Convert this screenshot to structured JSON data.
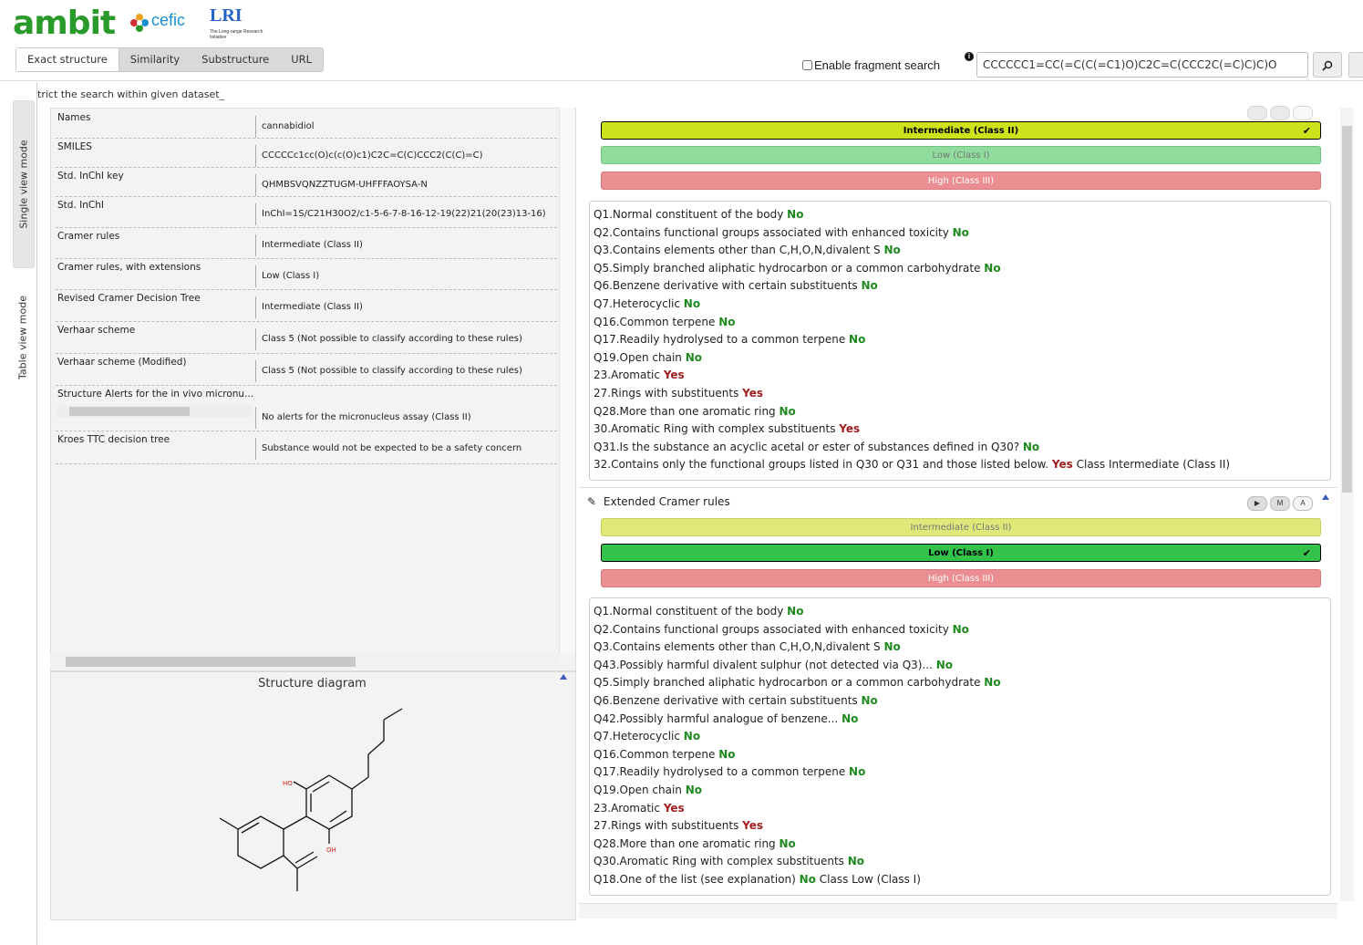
{
  "brand": {
    "logo": "ambit",
    "partner1": "cefic",
    "partner2": "LRI",
    "partner2_sub": "The Long-range Research Initiative"
  },
  "tabs": [
    {
      "label": "Exact structure"
    },
    {
      "label": "Similarity"
    },
    {
      "label": "Substructure"
    },
    {
      "label": "URL"
    }
  ],
  "search": {
    "fragment_label": "Enable fragment search",
    "fragment_checked": false,
    "value": "CCCCCC1=CC(=C(C(=C1)O)C2C=C(CCC2C(=C)C)C)O"
  },
  "side_tabs": {
    "single": "Single view mode",
    "table": "Table view mode"
  },
  "restrict_text": "trict the search within given dataset_",
  "properties": [
    {
      "name": "Names",
      "value": "cannabidiol"
    },
    {
      "name": "SMILES",
      "value": "CCCCCc1cc(O)c(c(O)c1)C2C=C(C)CCC2(C(C)=C)"
    },
    {
      "name": "Std. InChI key",
      "value": "QHMBSVQNZZTUGM-UHFFFAOYSA-N"
    },
    {
      "name": "Std. InChI",
      "value": "InChI=1S/C21H30O2/c1-5-6-7-8-16-12-19(22)21(20(23)13-16)"
    },
    {
      "name": "Cramer rules",
      "value": "Intermediate (Class II)"
    },
    {
      "name": "Cramer rules, with extensions",
      "value": "Low (Class I)"
    },
    {
      "name": "Revised Cramer Decision Tree",
      "value": "Intermediate (Class II)"
    },
    {
      "name": "Verhaar scheme",
      "value": "Class 5 (Not possible to classify according to these rules)"
    },
    {
      "name": "Verhaar scheme (Modified)",
      "value": "Class 5 (Not possible to classify according to these rules)"
    },
    {
      "name": "Structure Alerts for the in vivo micronu...",
      "value": "No alerts for the micronucleus assay (Class II)"
    },
    {
      "name": "Kroes TTC decision tree",
      "value": "Substance would not be expected to be a safety concern"
    }
  ],
  "structure": {
    "title": "Structure diagram",
    "atoms": {
      "ho": "HO",
      "oh": "OH"
    }
  },
  "cramer": {
    "classes": {
      "intermediate": "Intermediate (Class II)",
      "low": "Low (Class I)",
      "high": "High (Class III)"
    },
    "questions": [
      {
        "q": "Q1.Normal constituent of the body ",
        "a": "No"
      },
      {
        "q": "Q2.Contains functional groups associated with enhanced toxicity ",
        "a": "No"
      },
      {
        "q": "Q3.Contains elements other than C,H,O,N,divalent S ",
        "a": "No"
      },
      {
        "q": "Q5.Simply branched aliphatic hydrocarbon or a common carbohydrate ",
        "a": "No"
      },
      {
        "q": "Q6.Benzene derivative with certain substituents ",
        "a": "No"
      },
      {
        "q": "Q7.Heterocyclic ",
        "a": "No"
      },
      {
        "q": "Q16.Common terpene ",
        "a": "No"
      },
      {
        "q": "Q17.Readily hydrolysed to a common terpene ",
        "a": "No"
      },
      {
        "q": "Q19.Open chain ",
        "a": "No"
      },
      {
        "q": "23.Aromatic ",
        "a": "Yes"
      },
      {
        "q": "27.Rings with substituents ",
        "a": "Yes"
      },
      {
        "q": "Q28.More than one aromatic ring ",
        "a": "No"
      },
      {
        "q": "30.Aromatic Ring with complex substituents ",
        "a": "Yes"
      },
      {
        "q": "Q31.Is the substance an acyclic acetal or ester of substances defined in Q30? ",
        "a": "No"
      },
      {
        "q": "32.Contains only the functional groups listed in Q30 or Q31 and those listed below. ",
        "a": "Yes",
        "tail": " Class Intermediate (Class II)"
      }
    ]
  },
  "extended": {
    "title": "Extended Cramer rules",
    "buttons": [
      "▶",
      "M",
      "A"
    ],
    "questions": [
      {
        "q": "Q1.Normal constituent of the body ",
        "a": "No"
      },
      {
        "q": "Q2.Contains functional groups associated with enhanced toxicity ",
        "a": "No"
      },
      {
        "q": "Q3.Contains elements other than C,H,O,N,divalent S ",
        "a": "No"
      },
      {
        "q": "Q43.Possibly harmful divalent sulphur (not detected via Q3)... ",
        "a": "No"
      },
      {
        "q": "Q5.Simply branched aliphatic hydrocarbon or a common carbohydrate ",
        "a": "No"
      },
      {
        "q": "Q6.Benzene derivative with certain substituents ",
        "a": "No"
      },
      {
        "q": "Q42.Possibly harmful analogue of benzene... ",
        "a": "No"
      },
      {
        "q": "Q7.Heterocyclic ",
        "a": "No"
      },
      {
        "q": "Q16.Common terpene ",
        "a": "No"
      },
      {
        "q": "Q17.Readily hydrolysed to a common terpene ",
        "a": "No"
      },
      {
        "q": "Q19.Open chain ",
        "a": "No"
      },
      {
        "q": "23.Aromatic ",
        "a": "Yes"
      },
      {
        "q": "27.Rings with substituents ",
        "a": "Yes"
      },
      {
        "q": "Q28.More than one aromatic ring ",
        "a": "No"
      },
      {
        "q": "Q30.Aromatic Ring with complex substituents ",
        "a": "No"
      },
      {
        "q": "Q18.One of the list (see explanation) ",
        "a": "No",
        "tail": " Class Low (Class I)"
      }
    ]
  },
  "colors": {
    "yes": "#a01e1e",
    "no": "#1e8a1e",
    "intermediate_sel": "#cde21b",
    "low_sel": "#33c24a",
    "high": "#eb8e91"
  },
  "icons": {
    "search_button": "search-icon",
    "edit": "pencil-icon",
    "check": "checkmark-icon",
    "info": "info-icon"
  }
}
